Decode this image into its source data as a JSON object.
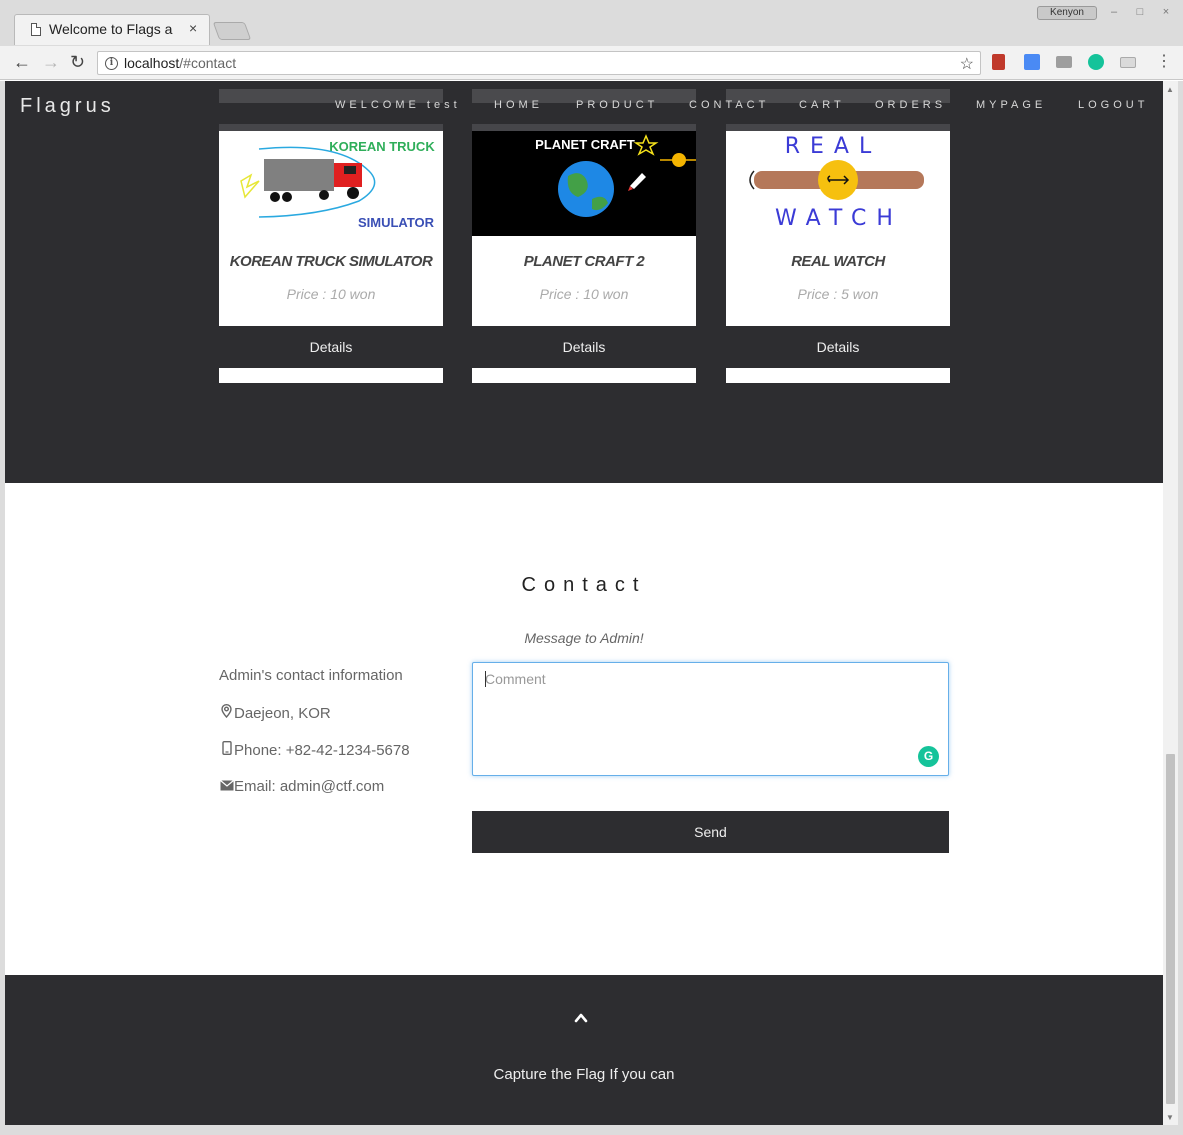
{
  "browser": {
    "tab_title": "Welcome to Flags a",
    "tab_close": "×",
    "url_host": "localhost",
    "url_path": "/#contact",
    "profile_name": "Kenyon",
    "back": "←",
    "forward": "→",
    "reload": "↻",
    "star": "☆",
    "menu": "⋮",
    "info": "i"
  },
  "nav": {
    "brand": "Flagrus",
    "welcome": "WELCOME test",
    "items": [
      "HOME",
      "PRODUCT",
      "CONTACT",
      "CART",
      "ORDERS",
      "MYPAGE",
      "LOGOUT"
    ]
  },
  "products": [
    {
      "title": "KOREAN TRUCK SIMULATOR",
      "price": "Price : 10 won",
      "button": "Details",
      "img_text_top": "KOREAN TRUCK",
      "img_text_bottom": "SIMULATOR"
    },
    {
      "title": "PLANET CRAFT 2",
      "price": "Price : 10 won",
      "button": "Details",
      "img_text_top": "PLANET CRAFT"
    },
    {
      "title": "REAL WATCH",
      "price": "Price : 5 won",
      "button": "Details",
      "img_text_top": "REAL",
      "img_text_bottom": "WATCH"
    }
  ],
  "contact": {
    "heading": "Contact",
    "subtitle": "Message to Admin!",
    "info_label": "Admin's contact information",
    "location": "Daejeon, KOR",
    "phone": "Phone: +82-42-1234-5678",
    "email": "Email: admin@ctf.com",
    "comment_placeholder": "Comment",
    "send_label": "Send"
  },
  "footer": {
    "text": "Capture the Flag If you can"
  },
  "colors": {
    "dark": "#2d2d30",
    "focus_border": "#66afe9",
    "grammarly": "#15c39a"
  }
}
